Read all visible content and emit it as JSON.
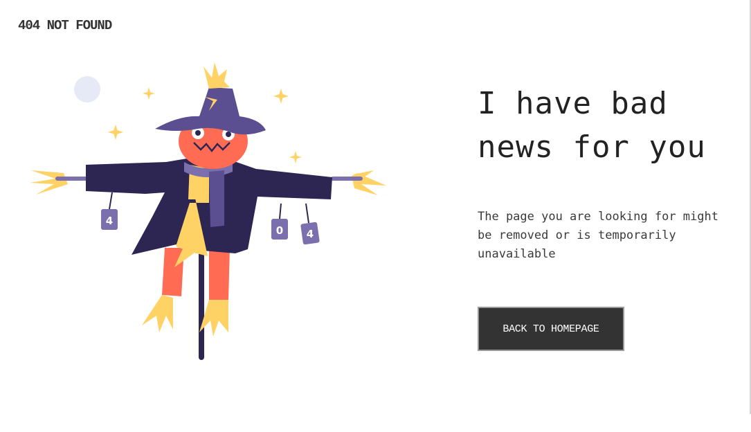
{
  "header": {
    "brand_text": "404 NOT FOUND"
  },
  "main": {
    "headline": "I have bad news for you",
    "message": "The page you are looking for might be removed or is temporarily unavailable",
    "button_label": "BACK TO HOMEPAGE"
  },
  "illustration": {
    "subject": "scarecrow",
    "can_labels": [
      "4",
      "0",
      "4"
    ]
  },
  "colors": {
    "text": "#222222",
    "button_bg": "#333333",
    "button_border": "#9a9a9a",
    "coat": "#2d2552",
    "hat": "#5c4f91",
    "head": "#ff6b53",
    "straw": "#ffd265",
    "can": "#7b6fae"
  }
}
